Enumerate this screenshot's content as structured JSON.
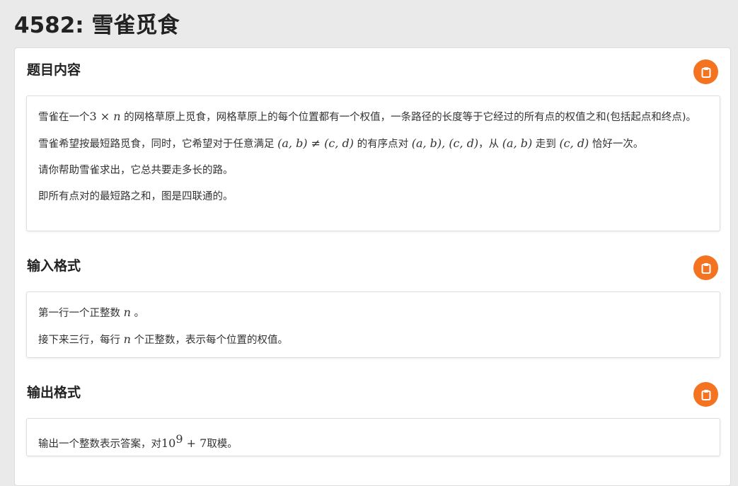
{
  "page": {
    "title": "4582: 雪雀觅食"
  },
  "sections": {
    "description": {
      "title": "题目内容",
      "p1_a": "雪雀在一个",
      "p1_m1": "3 × ",
      "p1_m2": "n",
      "p1_b": " 的网格草原上觅食，网格草原上的每个位置都有一个权值，一条路径的长度等于它经过的所有点的权值之和(包括起点和终点)。",
      "p2_a": "雪雀希望按最短路觅食，同时，它希望对于任意满足 ",
      "p2_m1": "(a, b) ≠ (c, d)",
      "p2_b": " 的有序点对 ",
      "p2_m2": "(a, b), (c, d)",
      "p2_c": "，从 ",
      "p2_m3": "(a, b)",
      "p2_d": " 走到 ",
      "p2_m4": "(c, d)",
      "p2_e": " 恰好一次。",
      "p3": "请你帮助雪雀求出，它总共要走多长的路。",
      "p4": "即所有点对的最短路之和，图是四联通的。"
    },
    "input": {
      "title": "输入格式",
      "p1_a": "第一行一个正整数 ",
      "p1_m": "n",
      "p1_b": " 。",
      "p2_a": "接下来三行，每行 ",
      "p2_m": "n",
      "p2_b": " 个正整数，表示每个位置的权值。"
    },
    "output": {
      "title": "输出格式",
      "p1_a": "输出一个整数表示答案，对",
      "p1_m_base": "10",
      "p1_m_exp": "9",
      "p1_m_rest": " + 7",
      "p1_b": "取模。"
    }
  },
  "icons": {
    "copy": "clipboard-icon"
  },
  "colors": {
    "accent": "#f37321"
  }
}
